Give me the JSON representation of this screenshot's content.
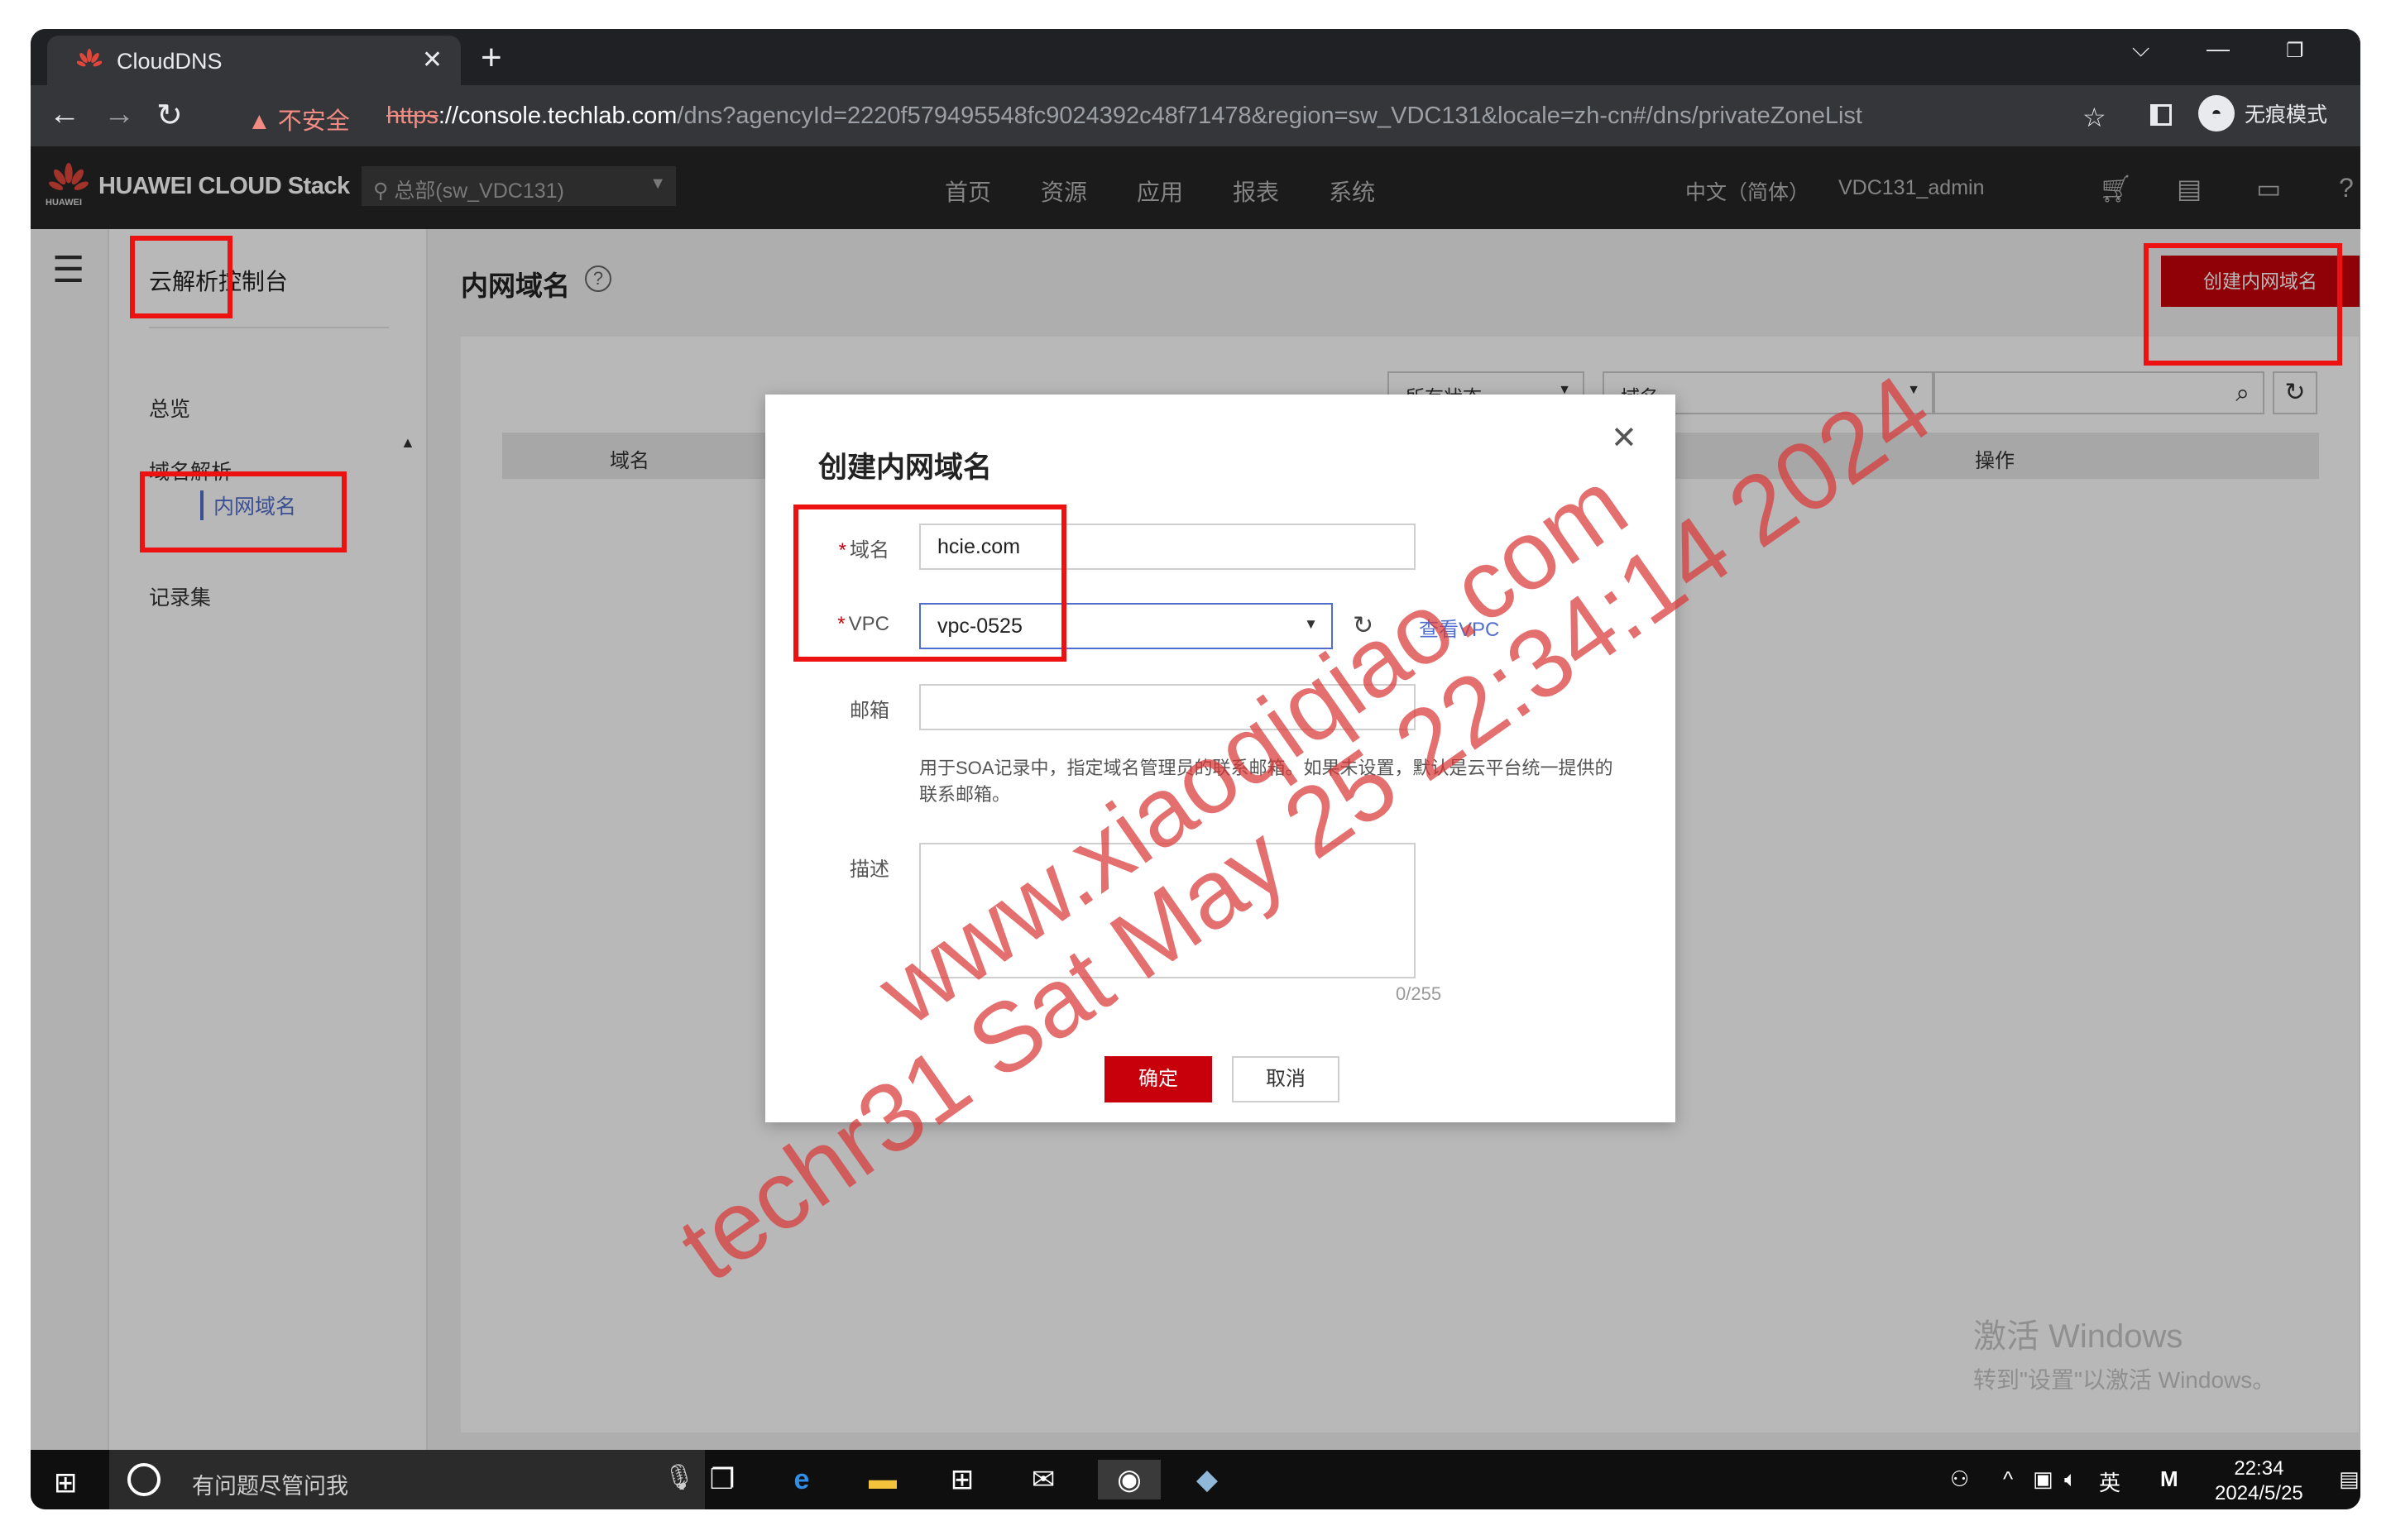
{
  "browser": {
    "tab_title": "CloudDNS",
    "new_tab": "+",
    "security_warning": "不安全",
    "url_scheme": "https",
    "url_host": "://console.techlab.com",
    "url_path": "/dns?agencyId=2220f579495548fc9024392c48f71478&region=sw_VDC131&locale=zh-cn#/dns/privateZoneList",
    "incognito_label": "无痕模式"
  },
  "header": {
    "brand": "HUAWEI CLOUD Stack",
    "logo_small": "HUAWEI",
    "region": "总部(sw_VDC131)",
    "nav": [
      "首页",
      "资源",
      "应用",
      "报表",
      "系统"
    ],
    "language": "中文（简体）",
    "user": "VDC131_admin"
  },
  "sidebar": {
    "title": "云解析控制台",
    "items": [
      "总览",
      "域名解析",
      "内网域名",
      "记录集"
    ]
  },
  "page": {
    "title": "内网域名",
    "create_button": "创建内网域名",
    "filter_status": "所有状态",
    "filter_field": "域名",
    "columns": [
      "域名",
      "操作"
    ]
  },
  "dialog": {
    "title": "创建内网域名",
    "domain_label": "域名",
    "domain_value": "hcie.com",
    "vpc_label": "VPC",
    "vpc_value": "vpc-0525",
    "view_vpc_link": "查看VPC",
    "email_label": "邮箱",
    "email_value": "",
    "email_hint": "用于SOA记录中，指定域名管理员的联系邮箱。如果未设置，默认是云平台统一提供的联系邮箱。",
    "desc_label": "描述",
    "desc_value": "",
    "desc_count": "0/255",
    "ok_button": "确定",
    "cancel_button": "取消"
  },
  "watermark": {
    "line1": "www.xiaoqiqiao.com",
    "line2": "techr31 Sat May 25 22:34:14 2024"
  },
  "os": {
    "activate_title": "激活 Windows",
    "activate_sub": "转到\"设置\"以激活 Windows。",
    "search_placeholder": "有问题尽管问我",
    "ime": "英",
    "time": "22:34",
    "date": "2024/5/25"
  },
  "colors": {
    "accent_red": "#c7000b",
    "link_blue": "#526ecc",
    "annotation_red": "#ee1111"
  }
}
